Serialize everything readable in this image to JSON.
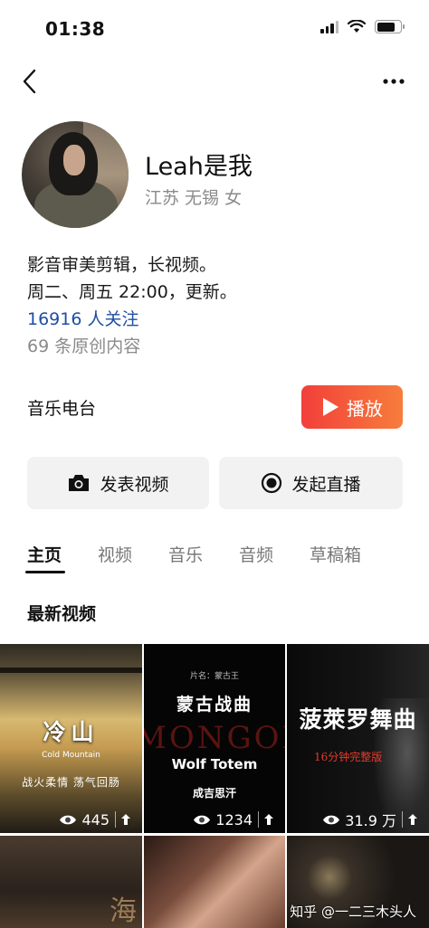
{
  "status_bar": {
    "time": "01:38"
  },
  "profile": {
    "name": "Leah是我",
    "location": "江苏 无锡 女",
    "bio_line1": "影音审美剪辑，长视频。",
    "bio_line2": "周二、周五 22:00，更新。",
    "followers": "16916 人关注",
    "originals": "69 条原创内容"
  },
  "radio": {
    "label": "音乐电台",
    "play_label": "播放"
  },
  "actions": {
    "post_video": "发表视频",
    "start_live": "发起直播"
  },
  "tabs": [
    "主页",
    "视频",
    "音乐",
    "音频",
    "草稿箱"
  ],
  "active_tab": "主页",
  "section_title": "最新视频",
  "videos": [
    {
      "views": "445",
      "title": "冷山",
      "subtitle": "Cold Mountain",
      "tagline": "战火柔情  荡气回肠"
    },
    {
      "views": "1234",
      "caption": "片名：蒙古王",
      "title_cn": "蒙古战曲",
      "bg_word": "MONGOL",
      "title_en": "Wolf Totem",
      "subtitle": "成吉思汗"
    },
    {
      "views": "31.9 万",
      "title": "菠萊罗舞曲",
      "subtitle": "16分钟完整版"
    },
    {
      "glyph": "海"
    },
    {},
    {}
  ],
  "watermark": "知乎 @一二三木头人",
  "colors": {
    "accent_link": "#1e4ea3",
    "play_gradient_start": "#f23f3a",
    "play_gradient_end": "#f77d3c",
    "muted_text": "#8a8a8a"
  }
}
